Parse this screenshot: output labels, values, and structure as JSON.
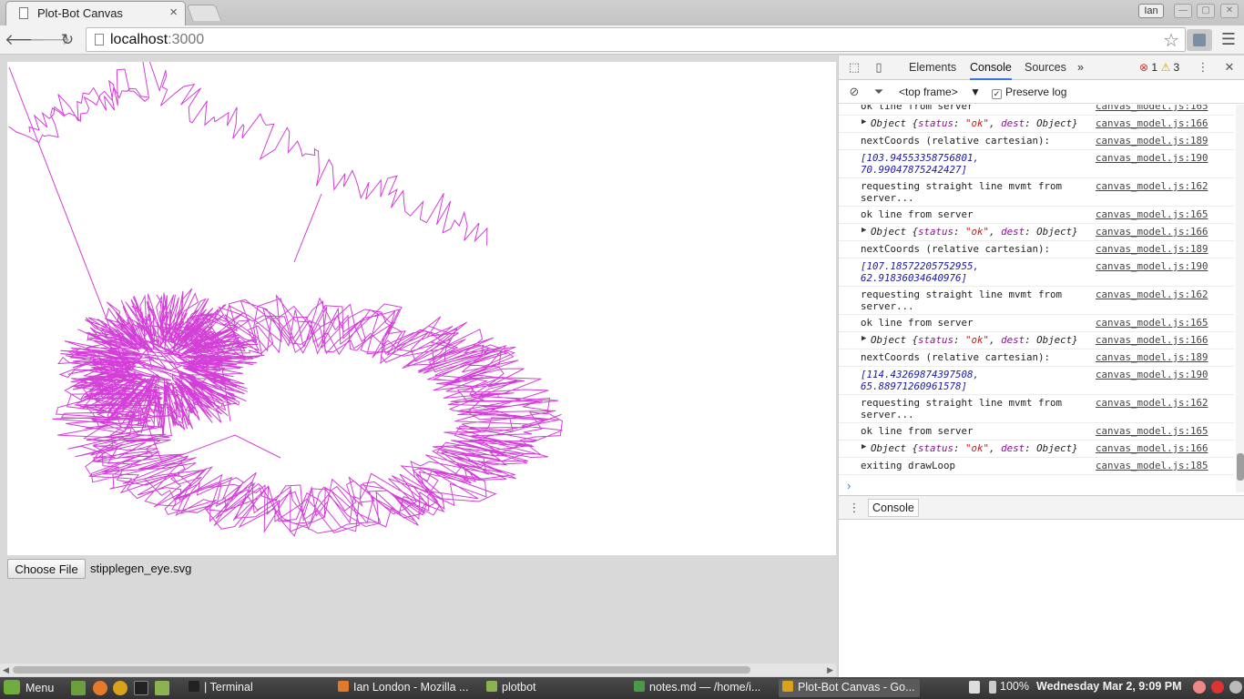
{
  "browser": {
    "tab_title": "Plot-Bot Canvas",
    "tab_close": "×",
    "user_badge": "Ian",
    "url_host": "localhost",
    "url_port": ":3000"
  },
  "page": {
    "choose_file_label": "Choose File",
    "file_name": "stipplegen_eye.svg",
    "plot_color": "#d33fd8"
  },
  "devtools": {
    "tabs": [
      "Elements",
      "Console",
      "Sources"
    ],
    "more_tabs": "»",
    "error_count": "1",
    "warning_count": "3",
    "frame_select": "<top frame>",
    "preserve_log_label": "Preserve log",
    "drawer_tab": "Console",
    "log": [
      {
        "kind": "text",
        "msg": "ok line from server",
        "src": "canvas_model.js:165"
      },
      {
        "kind": "obj",
        "msg": "Object {status: \"ok\", dest: Object}",
        "src": "canvas_model.js:166"
      },
      {
        "kind": "text",
        "msg": "nextCoords (relative cartesian):",
        "src": "canvas_model.js:189"
      },
      {
        "kind": "array",
        "msg": "[103.94553358756801, 70.99047875242427]",
        "src": "canvas_model.js:190"
      },
      {
        "kind": "text",
        "msg": "requesting straight line mvmt from server...",
        "src": "canvas_model.js:162"
      },
      {
        "kind": "text",
        "msg": "ok line from server",
        "src": "canvas_model.js:165"
      },
      {
        "kind": "obj",
        "msg": "Object {status: \"ok\", dest: Object}",
        "src": "canvas_model.js:166"
      },
      {
        "kind": "text",
        "msg": "nextCoords (relative cartesian):",
        "src": "canvas_model.js:189"
      },
      {
        "kind": "array",
        "msg": "[107.18572205752955, 62.91836034640976]",
        "src": "canvas_model.js:190"
      },
      {
        "kind": "text",
        "msg": "requesting straight line mvmt from server...",
        "src": "canvas_model.js:162"
      },
      {
        "kind": "text",
        "msg": "ok line from server",
        "src": "canvas_model.js:165"
      },
      {
        "kind": "obj",
        "msg": "Object {status: \"ok\", dest: Object}",
        "src": "canvas_model.js:166"
      },
      {
        "kind": "text",
        "msg": "nextCoords (relative cartesian):",
        "src": "canvas_model.js:189"
      },
      {
        "kind": "array",
        "msg": "[114.43269874397508, 65.88971260961578]",
        "src": "canvas_model.js:190"
      },
      {
        "kind": "text",
        "msg": "requesting straight line mvmt from server...",
        "src": "canvas_model.js:162"
      },
      {
        "kind": "text",
        "msg": "ok line from server",
        "src": "canvas_model.js:165"
      },
      {
        "kind": "obj",
        "msg": "Object {status: \"ok\", dest: Object}",
        "src": "canvas_model.js:166"
      },
      {
        "kind": "text",
        "msg": "exiting drawLoop",
        "src": "canvas_model.js:185"
      }
    ]
  },
  "taskbar": {
    "menu_label": "Menu",
    "tasks": [
      {
        "label": "| Terminal",
        "active": false
      },
      {
        "label": "Ian London - Mozilla ...",
        "active": false
      },
      {
        "label": "plotbot",
        "active": false
      },
      {
        "label": "notes.md — /home/i...",
        "active": false
      },
      {
        "label": "Plot-Bot Canvas - Go...",
        "active": true
      }
    ],
    "battery": "100%",
    "clock": "Wednesday Mar  2,  9:09 PM"
  }
}
